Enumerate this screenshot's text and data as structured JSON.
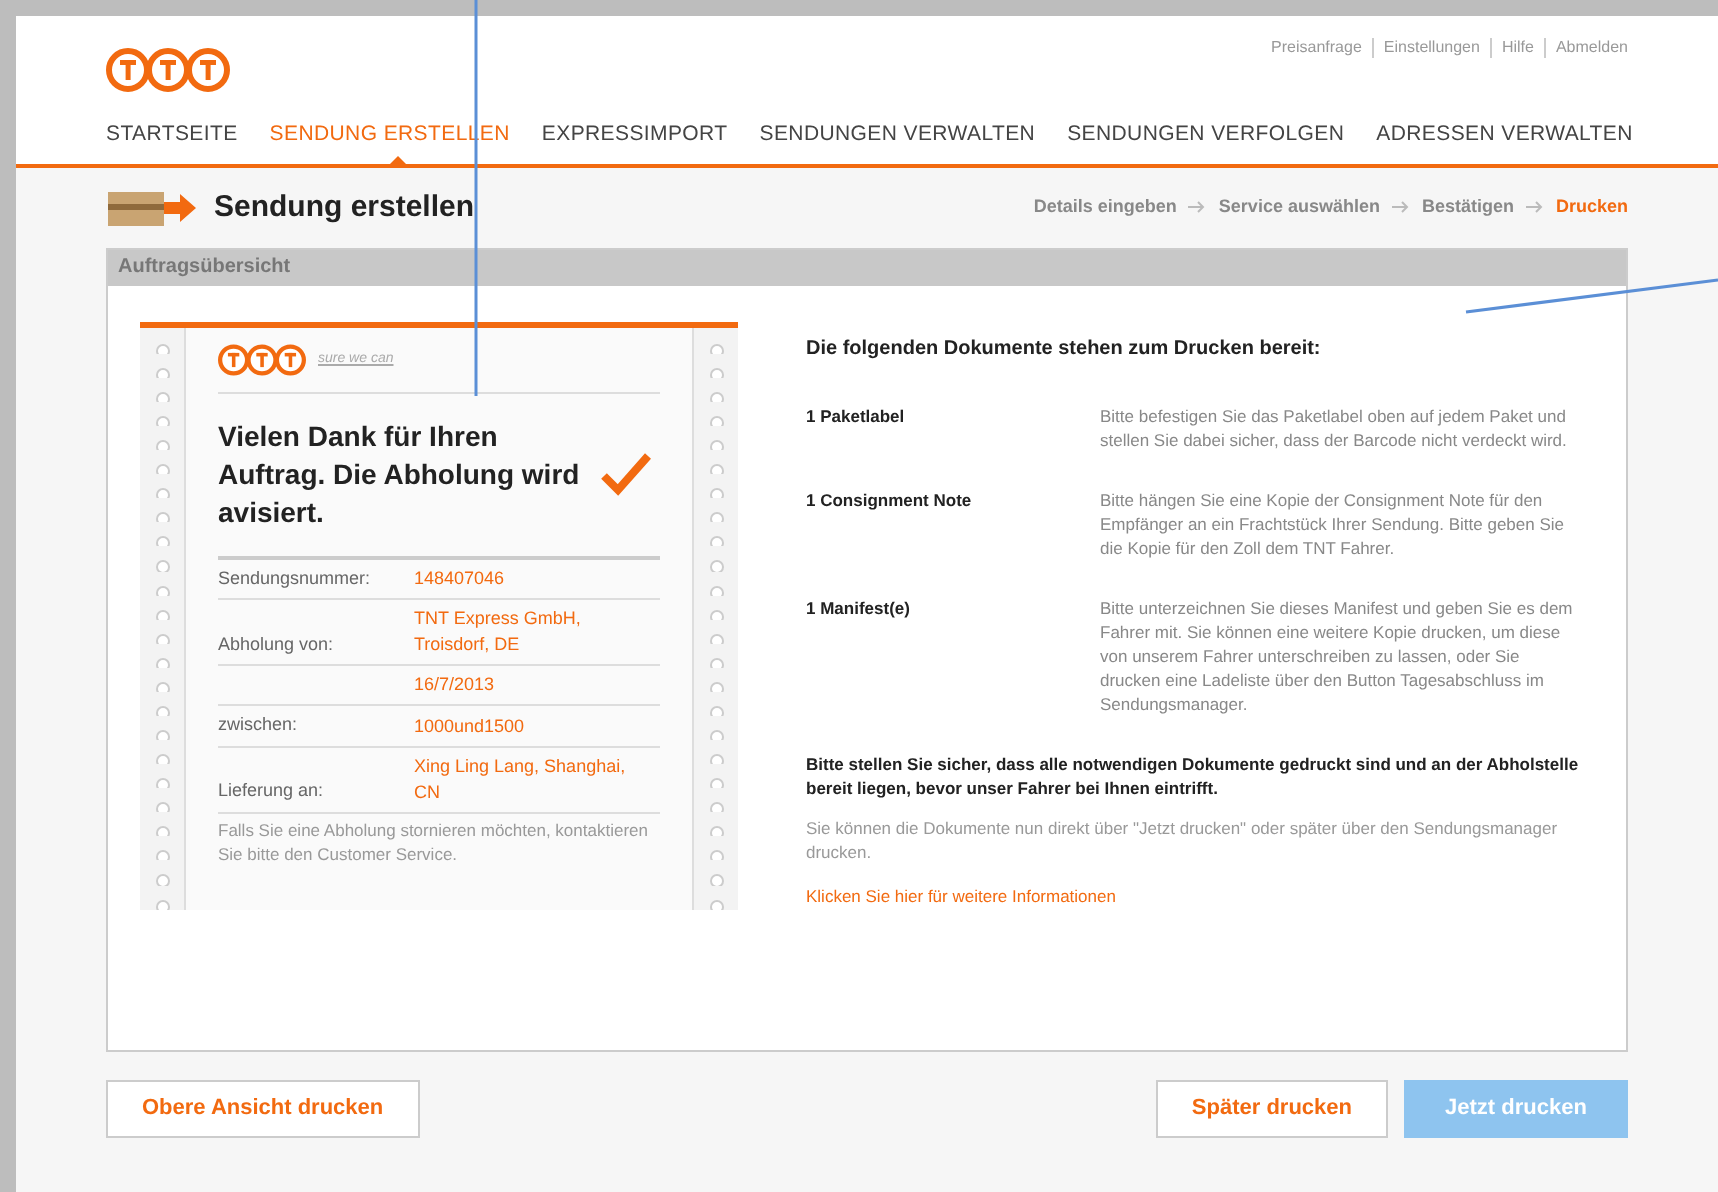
{
  "top_links": [
    "Preisanfrage",
    "Einstellungen",
    "Hilfe",
    "Abmelden"
  ],
  "nav": [
    {
      "label": "STARTSEITE",
      "selected": false
    },
    {
      "label": "SENDUNG ERSTELLEN",
      "selected": true
    },
    {
      "label": "EXPRESSIMPORT",
      "selected": false
    },
    {
      "label": "SENDUNGEN VERWALTEN",
      "selected": false
    },
    {
      "label": "SENDUNGEN VERFOLGEN",
      "selected": false
    },
    {
      "label": "ADRESSEN VERWALTEN",
      "selected": false
    }
  ],
  "page_title": "Sendung erstellen",
  "steps": [
    {
      "label": "Details eingeben",
      "selected": false
    },
    {
      "label": "Service auswählen",
      "selected": false
    },
    {
      "label": "Bestätigen",
      "selected": false
    },
    {
      "label": "Drucken",
      "selected": true
    }
  ],
  "panel_title": "Auftragsübersicht",
  "receipt": {
    "tagline": "sure we can",
    "heading": "Vielen Dank für Ihren Auftrag. Die Abholung wird avisiert.",
    "rows": [
      {
        "label": "Sendungsnummer:",
        "value": "148407046"
      },
      {
        "label": "Abholung von:",
        "value": "TNT Express GmbH, Troisdorf, DE"
      },
      {
        "label": "",
        "value": "16/7/2013"
      },
      {
        "label": "zwischen:",
        "value": "1000und1500"
      },
      {
        "label": "Lieferung an:",
        "value": "Xing Ling Lang, Shanghai, CN"
      }
    ],
    "note": "Falls Sie eine Abholung stornieren möchten, kontaktieren Sie bitte den Customer Service."
  },
  "documents_heading": "Die folgenden Dokumente stehen zum Drucken bereit:",
  "documents": [
    {
      "name": "1 Paketlabel",
      "text": "Bitte befestigen Sie das Paketlabel oben auf jedem Paket und stellen Sie dabei sicher, dass der Barcode nicht verdeckt wird."
    },
    {
      "name": "1 Consignment Note",
      "text": "Bitte hängen Sie eine Kopie der Consignment Note für den Empfänger an ein Frachtstück Ihrer Sendung. Bitte geben Sie die Kopie für den Zoll dem TNT Fahrer."
    },
    {
      "name": "1 Manifest(e)",
      "text": "Bitte unterzeichnen Sie dieses Manifest und geben Sie es dem Fahrer mit. Sie können eine weitere Kopie drucken, um diese von unserem Fahrer unterschreiben zu lassen, oder Sie drucken eine Ladeliste über den Button Tagesabschluss im Sendungsmanager."
    }
  ],
  "warning": "Bitte stellen Sie sicher, dass alle notwendigen Dokumente gedruckt sind und an der Abholstelle bereit liegen, bevor unser Fahrer bei Ihnen eintrifft.",
  "info": "Sie können die Dokumente nun direkt über \"Jetzt drucken\" oder später über den Sendungsmanager drucken.",
  "more_link": "Klicken Sie hier für weitere Informationen",
  "buttons": [
    {
      "label": "Obere Ansicht drucken",
      "kind": "secondary"
    },
    {
      "label": "Später drucken",
      "kind": "secondary"
    },
    {
      "label": "Jetzt drucken",
      "kind": "primary"
    }
  ]
}
